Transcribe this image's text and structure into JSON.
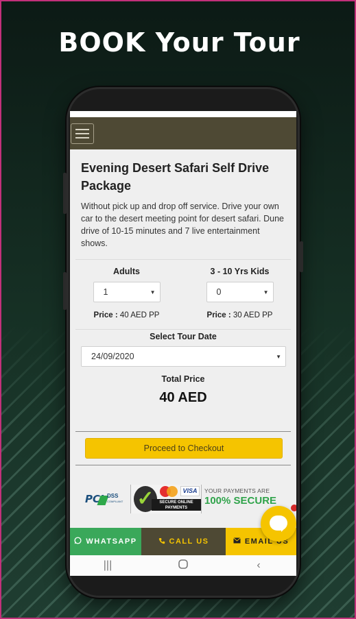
{
  "promo": {
    "headline": "BOOK Your Tour"
  },
  "package": {
    "title": "Evening Desert Safari Self Drive Package",
    "description": "Without pick up and drop off service. Drive your own car to the desert meeting point for desert safari. Dune drive of 10-15 minutes and 7 live entertainment shows."
  },
  "adults": {
    "label": "Adults",
    "value": "1",
    "price_prefix": "Price :",
    "price": "40 AED PP"
  },
  "kids": {
    "label": "3 - 10 Yrs Kids",
    "value": "0",
    "price_prefix": "Price :",
    "price": "30 AED PP"
  },
  "tour_date": {
    "label": "Select Tour Date",
    "value": "24/09/2020"
  },
  "total": {
    "label": "Total Price",
    "value": "40 AED"
  },
  "checkout_label": "Proceed to Checkout",
  "trust_badges": {
    "pci": "PCI",
    "pci_dss": "DSS",
    "pci_compliant": "COMPLIANT",
    "visa": "VISA",
    "secure_line1": "SECURE ONLINE",
    "secure_line2": "PAYMENTS",
    "payments_top": "YOUR PAYMENTS ARE",
    "payments_big": "100% SECURE"
  },
  "bottom_bar": {
    "whatsapp": "WHATSAPP",
    "call": "CALL US",
    "email": "EMAIL US"
  },
  "icons": {
    "menu": "hamburger-icon",
    "whatsapp": "whatsapp-icon",
    "call": "phone-icon",
    "email": "envelope-icon",
    "chat": "chat-icon",
    "nav_recents": "recents-icon",
    "nav_home": "home-icon",
    "nav_back": "back-icon"
  },
  "colors": {
    "topbar": "#4e4934",
    "accent_yellow": "#f5c400",
    "whatsapp_green": "#3aa85a",
    "frame_border": "#c2307a"
  }
}
